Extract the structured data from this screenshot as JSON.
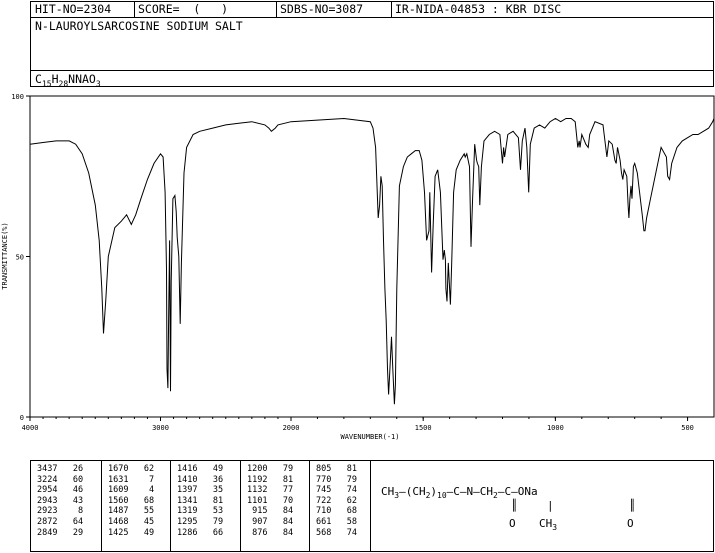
{
  "header": {
    "hit_no": "HIT-NO=2304",
    "score": "SCORE=  (   )",
    "sdbs_no": "SDBS-NO=3087",
    "ir_nida": "IR-NIDA-04853 : KBR DISC",
    "compound_name": "N-LAUROYLSARCOSINE SODIUM SALT",
    "formula": {
      "parts": [
        "C",
        "15",
        "H",
        "28",
        "NNAO",
        "3"
      ]
    }
  },
  "chart_data": {
    "type": "line",
    "xlabel": "WAVENUMBER(-1)",
    "ylabel": "TRANSMITTANCE(%)",
    "xlim": [
      4000,
      400
    ],
    "ylim": [
      0,
      100
    ],
    "x_ticks": [
      "4000",
      "3000",
      "2000",
      "1500",
      "1000",
      "500"
    ],
    "x_tick_values": [
      4000,
      3000,
      2000,
      1500,
      1000,
      500
    ],
    "y_ticks": [
      "0",
      "50",
      "100"
    ],
    "y_tick_values": [
      0,
      50,
      100
    ],
    "series": [
      {
        "points": [
          [
            4000,
            85
          ],
          [
            3900,
            85.5
          ],
          [
            3800,
            86
          ],
          [
            3700,
            86
          ],
          [
            3650,
            85
          ],
          [
            3600,
            82
          ],
          [
            3550,
            76
          ],
          [
            3500,
            66
          ],
          [
            3470,
            55
          ],
          [
            3450,
            40
          ],
          [
            3437,
            26
          ],
          [
            3420,
            36
          ],
          [
            3400,
            50
          ],
          [
            3350,
            59
          ],
          [
            3300,
            61
          ],
          [
            3260,
            63
          ],
          [
            3224,
            60
          ],
          [
            3190,
            63
          ],
          [
            3150,
            68
          ],
          [
            3100,
            74
          ],
          [
            3050,
            79
          ],
          [
            3000,
            82
          ],
          [
            2980,
            81
          ],
          [
            2965,
            70
          ],
          [
            2954,
            46
          ],
          [
            2950,
            15
          ],
          [
            2943,
            9
          ],
          [
            2938,
            30
          ],
          [
            2930,
            55
          ],
          [
            2923,
            8
          ],
          [
            2918,
            42
          ],
          [
            2905,
            68
          ],
          [
            2890,
            69
          ],
          [
            2880,
            64
          ],
          [
            2872,
            56
          ],
          [
            2860,
            50
          ],
          [
            2849,
            29
          ],
          [
            2840,
            48
          ],
          [
            2820,
            76
          ],
          [
            2800,
            84
          ],
          [
            2750,
            88
          ],
          [
            2700,
            89
          ],
          [
            2600,
            90
          ],
          [
            2500,
            91
          ],
          [
            2400,
            91.5
          ],
          [
            2300,
            92
          ],
          [
            2200,
            91
          ],
          [
            2170,
            90
          ],
          [
            2150,
            89
          ],
          [
            2120,
            90
          ],
          [
            2100,
            91
          ],
          [
            2000,
            92
          ],
          [
            1900,
            92.5
          ],
          [
            1800,
            93
          ],
          [
            1750,
            92.5
          ],
          [
            1700,
            92
          ],
          [
            1690,
            90
          ],
          [
            1680,
            84
          ],
          [
            1670,
            62
          ],
          [
            1665,
            66
          ],
          [
            1660,
            75
          ],
          [
            1655,
            72
          ],
          [
            1650,
            55
          ],
          [
            1645,
            40
          ],
          [
            1640,
            30
          ],
          [
            1635,
            15
          ],
          [
            1631,
            7
          ],
          [
            1627,
            13
          ],
          [
            1620,
            25
          ],
          [
            1615,
            15
          ],
          [
            1609,
            4
          ],
          [
            1605,
            10
          ],
          [
            1600,
            40
          ],
          [
            1590,
            72
          ],
          [
            1575,
            78
          ],
          [
            1560,
            81
          ],
          [
            1545,
            82
          ],
          [
            1530,
            83
          ],
          [
            1515,
            83
          ],
          [
            1505,
            80
          ],
          [
            1495,
            70
          ],
          [
            1487,
            55
          ],
          [
            1478,
            58
          ],
          [
            1475,
            70
          ],
          [
            1468,
            45
          ],
          [
            1462,
            60
          ],
          [
            1455,
            75
          ],
          [
            1445,
            77
          ],
          [
            1435,
            70
          ],
          [
            1425,
            49
          ],
          [
            1420,
            52
          ],
          [
            1416,
            49
          ],
          [
            1414,
            40
          ],
          [
            1410,
            36
          ],
          [
            1405,
            48
          ],
          [
            1397,
            35
          ],
          [
            1392,
            48
          ],
          [
            1385,
            70
          ],
          [
            1375,
            77
          ],
          [
            1360,
            80
          ],
          [
            1345,
            82
          ],
          [
            1341,
            81
          ],
          [
            1335,
            82
          ],
          [
            1325,
            78
          ],
          [
            1319,
            53
          ],
          [
            1313,
            68
          ],
          [
            1305,
            85
          ],
          [
            1298,
            80
          ],
          [
            1295,
            79
          ],
          [
            1290,
            78
          ],
          [
            1286,
            66
          ],
          [
            1280,
            78
          ],
          [
            1270,
            86
          ],
          [
            1250,
            88
          ],
          [
            1230,
            89
          ],
          [
            1210,
            88
          ],
          [
            1200,
            79
          ],
          [
            1196,
            84
          ],
          [
            1192,
            81
          ],
          [
            1180,
            88
          ],
          [
            1160,
            89
          ],
          [
            1140,
            87
          ],
          [
            1132,
            77
          ],
          [
            1125,
            86
          ],
          [
            1115,
            90
          ],
          [
            1108,
            84
          ],
          [
            1101,
            70
          ],
          [
            1095,
            85
          ],
          [
            1080,
            90
          ],
          [
            1060,
            91
          ],
          [
            1040,
            90
          ],
          [
            1020,
            92
          ],
          [
            1000,
            93
          ],
          [
            980,
            92
          ],
          [
            960,
            93
          ],
          [
            940,
            93
          ],
          [
            925,
            92
          ],
          [
            915,
            84
          ],
          [
            910,
            86
          ],
          [
            907,
            84
          ],
          [
            900,
            88
          ],
          [
            890,
            86
          ],
          [
            885,
            85
          ],
          [
            876,
            84
          ],
          [
            870,
            88
          ],
          [
            850,
            92
          ],
          [
            820,
            91
          ],
          [
            805,
            81
          ],
          [
            798,
            86
          ],
          [
            785,
            85
          ],
          [
            775,
            80
          ],
          [
            770,
            79
          ],
          [
            765,
            84
          ],
          [
            755,
            80
          ],
          [
            750,
            76
          ],
          [
            745,
            74
          ],
          [
            740,
            77
          ],
          [
            730,
            75
          ],
          [
            725,
            66
          ],
          [
            722,
            62
          ],
          [
            718,
            68
          ],
          [
            714,
            72
          ],
          [
            710,
            68
          ],
          [
            705,
            78
          ],
          [
            700,
            79
          ],
          [
            690,
            76
          ],
          [
            670,
            62
          ],
          [
            665,
            58
          ],
          [
            661,
            58
          ],
          [
            655,
            62
          ],
          [
            640,
            68
          ],
          [
            620,
            76
          ],
          [
            600,
            84
          ],
          [
            580,
            81
          ],
          [
            575,
            75
          ],
          [
            568,
            74
          ],
          [
            560,
            79
          ],
          [
            540,
            84
          ],
          [
            520,
            86
          ],
          [
            500,
            87
          ],
          [
            480,
            88
          ],
          [
            460,
            88
          ],
          [
            440,
            89
          ],
          [
            420,
            90
          ],
          [
            405,
            92
          ],
          [
            400,
            93
          ]
        ]
      }
    ]
  },
  "peak_table": {
    "columns": [
      [
        [
          "3437",
          "26"
        ],
        [
          "3224",
          "60"
        ],
        [
          "2954",
          "46"
        ],
        [
          "2943",
          "43"
        ],
        [
          "2923",
          "8"
        ],
        [
          "2872",
          "64"
        ],
        [
          "2849",
          "29"
        ]
      ],
      [
        [
          "1670",
          "62"
        ],
        [
          "1631",
          "7"
        ],
        [
          "1609",
          "4"
        ],
        [
          "1560",
          "68"
        ],
        [
          "1487",
          "55"
        ],
        [
          "1468",
          "45"
        ],
        [
          "1425",
          "49"
        ]
      ],
      [
        [
          "1416",
          "49"
        ],
        [
          "1410",
          "36"
        ],
        [
          "1397",
          "35"
        ],
        [
          "1341",
          "81"
        ],
        [
          "1319",
          "53"
        ],
        [
          "1295",
          "79"
        ],
        [
          "1286",
          "66"
        ]
      ],
      [
        [
          "1200",
          "79"
        ],
        [
          "1192",
          "81"
        ],
        [
          "1132",
          "77"
        ],
        [
          "1101",
          "70"
        ],
        [
          "915",
          "84"
        ],
        [
          "907",
          "84"
        ],
        [
          "876",
          "84"
        ]
      ],
      [
        [
          "805",
          "81"
        ],
        [
          "770",
          "79"
        ],
        [
          "745",
          "74"
        ],
        [
          "722",
          "62"
        ],
        [
          "710",
          "68"
        ],
        [
          "661",
          "58"
        ],
        [
          "568",
          "74"
        ]
      ]
    ]
  },
  "structure": {
    "main": [
      "CH",
      "3",
      "—(CH",
      "2",
      ")",
      "10",
      "—C—N—CH",
      "2",
      "—C—ONa"
    ],
    "o1": "O",
    "ch3": "CH",
    "ch3_sub": "3",
    "o2": "O"
  }
}
